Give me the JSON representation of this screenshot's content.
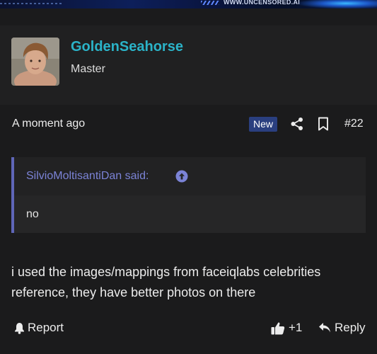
{
  "banner": {
    "site_text": "WWW.UNCENSORED.AI"
  },
  "post": {
    "author": {
      "username": "GoldenSeahorse",
      "title": "Master"
    },
    "timestamp": "A moment ago",
    "badge": "New",
    "post_number": "#22",
    "quote": {
      "author_said": "SilvioMoltisantiDan said:",
      "body": "no"
    },
    "message": "i used the images/mappings from faceiqlabs celebrities reference, they have better photos on there",
    "actions": {
      "report_label": "Report",
      "like_label": "+1",
      "reply_label": "Reply"
    }
  },
  "colors": {
    "background": "#1b1b1c",
    "user_block": "#202021",
    "username": "#2bb3c8",
    "badge": "#2a3f7f",
    "quote_border": "#5f66b8",
    "quote_author": "#7b83d6"
  },
  "icons": {
    "share": "share-icon",
    "bookmark": "bookmark-icon",
    "quote_link": "arrow-up-circle-icon",
    "report": "bell-icon",
    "like": "thumbs-up-icon",
    "reply": "reply-icon"
  }
}
